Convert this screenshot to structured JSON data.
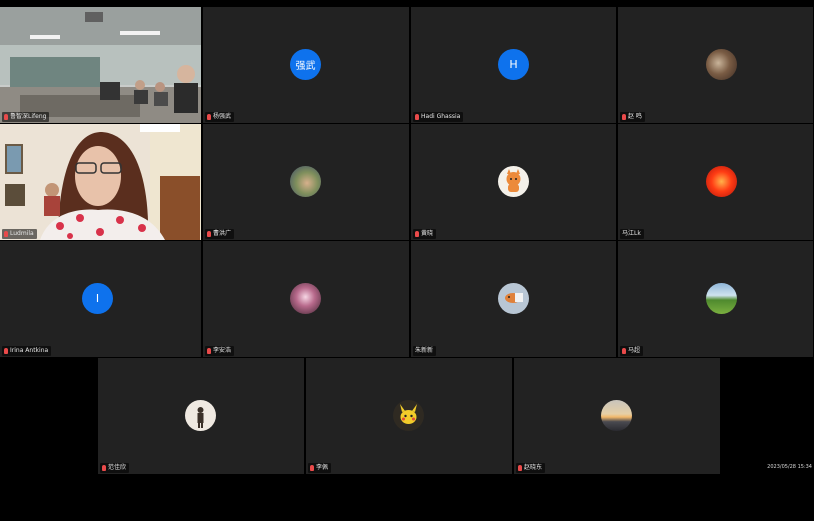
{
  "app": {
    "timestamp": "2023/05/28 15:34"
  },
  "row1": [
    {
      "name": "鲁智深Lifeng",
      "type": "video-classroom",
      "active": true
    },
    {
      "name": "杨强武",
      "type": "letter",
      "avatar_text": "强武",
      "avatar_color": "#0e72ed"
    },
    {
      "name": "Hadi Ghassia",
      "type": "letter",
      "avatar_text": "H",
      "avatar_color": "#0e72ed"
    },
    {
      "name": "赵 鸣",
      "type": "photo",
      "avatar_icon": "cat-photo-icon"
    }
  ],
  "row2": [
    {
      "name": "Ludmila",
      "type": "video-woman"
    },
    {
      "name": "曹洪广",
      "type": "photo",
      "avatar_icon": "hand-photo-icon"
    },
    {
      "name": "黄晓",
      "type": "photo",
      "avatar_icon": "cartoon-fox-icon"
    },
    {
      "name": "马江Lk",
      "type": "photo",
      "avatar_icon": "red-circle-icon"
    }
  ],
  "row3": [
    {
      "name": "Irina Antkina",
      "type": "letter",
      "avatar_text": "I",
      "avatar_color": "#0e72ed"
    },
    {
      "name": "李安浩",
      "type": "photo",
      "avatar_icon": "pink-blossom-icon"
    },
    {
      "name": "朱新新",
      "type": "photo",
      "avatar_icon": "cartoon-figure-icon"
    },
    {
      "name": "马超",
      "type": "photo",
      "avatar_icon": "landscape-icon"
    }
  ],
  "row4": [
    {
      "name": "范佳欣",
      "type": "photo",
      "avatar_icon": "person-silhouette-icon"
    },
    {
      "name": "李佩",
      "type": "photo",
      "avatar_icon": "pikachu-icon"
    },
    {
      "name": "赵晓东",
      "type": "photo",
      "avatar_icon": "sunset-icon"
    }
  ]
}
